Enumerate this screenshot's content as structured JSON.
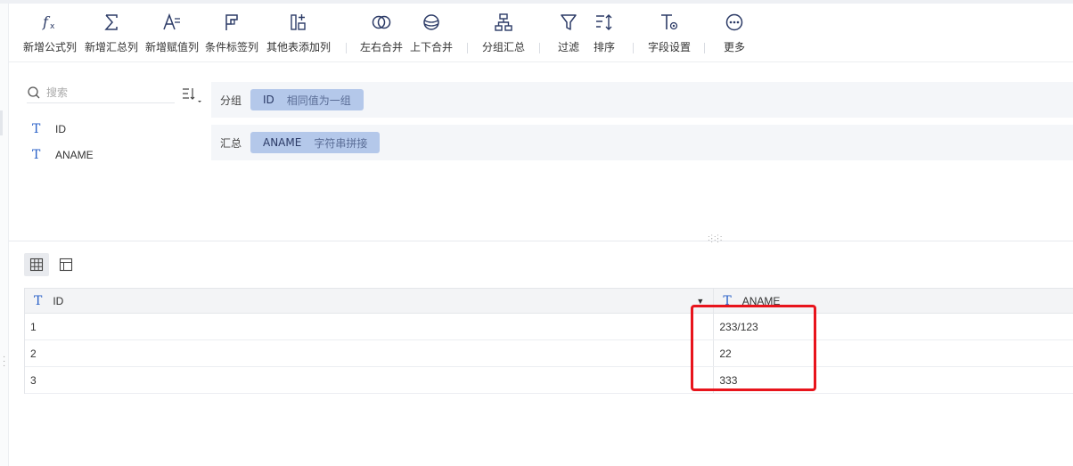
{
  "toolbar": {
    "items": [
      {
        "label": "新增公式列",
        "icon": "fx-icon"
      },
      {
        "label": "新增汇总列",
        "icon": "sigma-icon"
      },
      {
        "label": "新增赋值列",
        "icon": "assign-column-icon"
      },
      {
        "label": "条件标签列",
        "icon": "condition-flag-icon"
      },
      {
        "label": "其他表添加列",
        "icon": "add-from-table-icon"
      },
      {
        "label": "左右合并",
        "icon": "join-lr-icon"
      },
      {
        "label": "上下合并",
        "icon": "union-tb-icon"
      },
      {
        "label": "分组汇总",
        "icon": "group-summary-icon"
      },
      {
        "label": "过滤",
        "icon": "filter-icon"
      },
      {
        "label": "排序",
        "icon": "sort-icon"
      },
      {
        "label": "字段设置",
        "icon": "field-settings-icon"
      },
      {
        "label": "更多",
        "icon": "more-icon"
      }
    ]
  },
  "search": {
    "placeholder": "搜索"
  },
  "fields": [
    {
      "type_glyph": "T",
      "name": "ID"
    },
    {
      "type_glyph": "T",
      "name": "ANAME"
    }
  ],
  "group_config": {
    "group_label": "分组",
    "group_chip": {
      "field": "ID",
      "mode": "相同值为一组"
    },
    "summary_label": "汇总",
    "summary_chip": {
      "field": "ANAME",
      "mode": "字符串拼接"
    }
  },
  "table": {
    "columns": [
      {
        "type_glyph": "T",
        "name": "ID"
      },
      {
        "type_glyph": "T",
        "name": "ANAME"
      }
    ],
    "rows": [
      [
        "1",
        "233/123"
      ],
      [
        "2",
        "22"
      ],
      [
        "3",
        "333"
      ]
    ]
  },
  "colors": {
    "accent": "#2b62c8",
    "chip": "#b4c8ea",
    "highlight": "#e8141c"
  }
}
